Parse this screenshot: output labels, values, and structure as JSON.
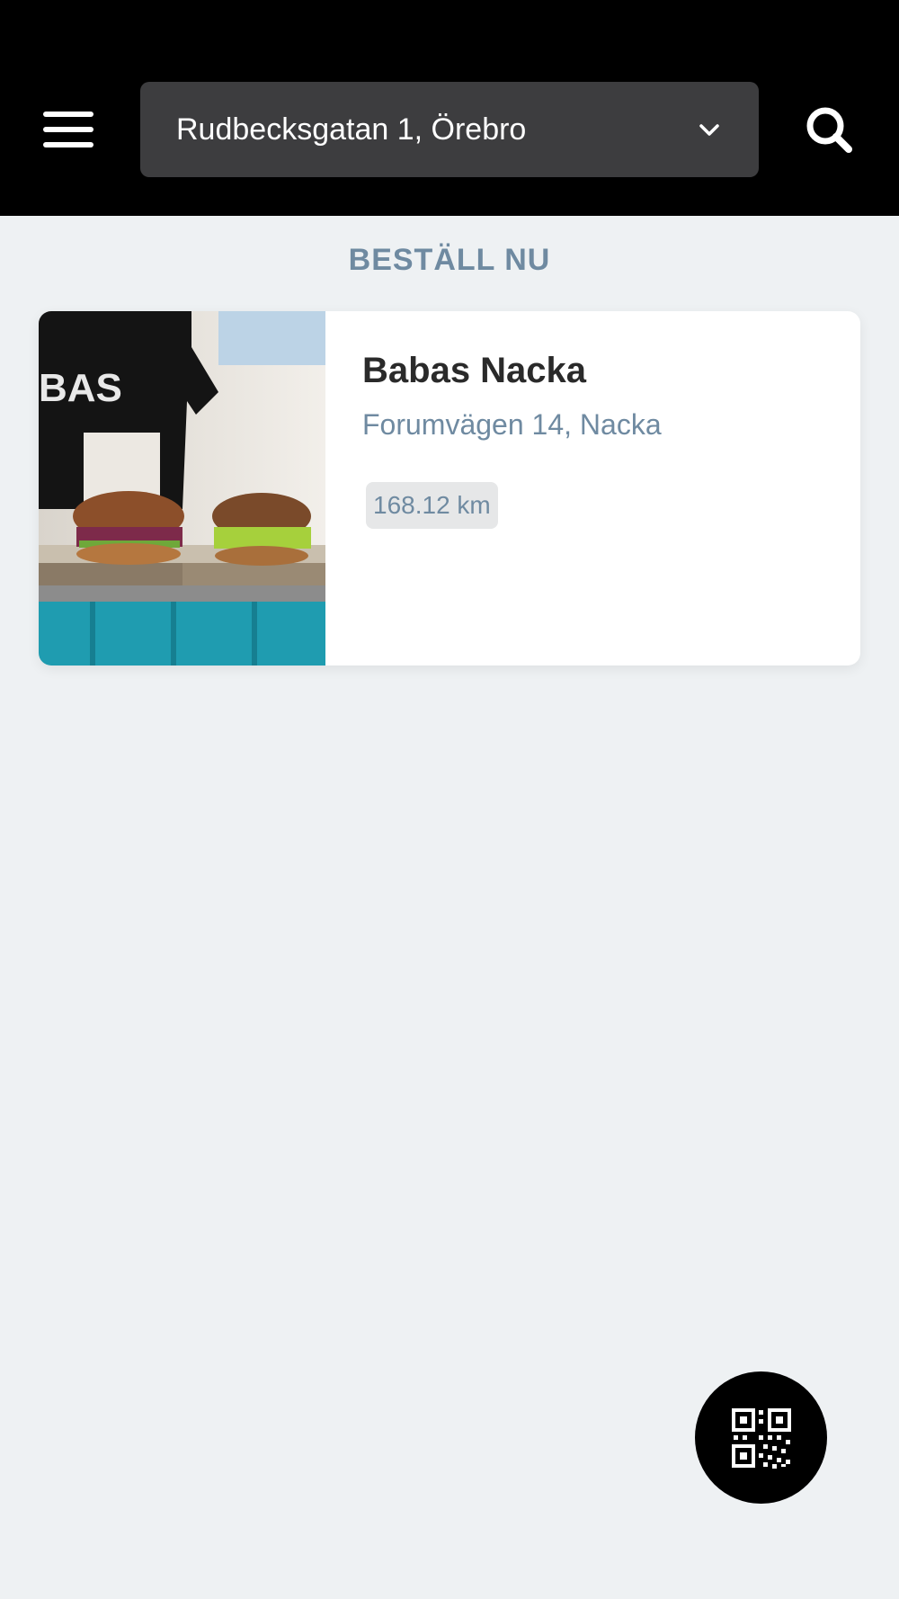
{
  "header": {
    "address": "Rudbecksgatan 1, Örebro",
    "menu_icon": "hamburger-menu-icon",
    "dropdown_icon": "chevron-down-icon",
    "search_icon": "search-icon"
  },
  "section": {
    "title": "BESTÄLL NU"
  },
  "restaurants": [
    {
      "name": "Babas Nacka",
      "address": "Forumvägen 14, Nacka",
      "distance": "168.12 km",
      "shirt_text": "BAS"
    }
  ],
  "fab": {
    "icon": "qr-code-icon"
  },
  "colors": {
    "header_bg": "#000000",
    "select_bg": "#3d3d3f",
    "page_bg": "#eef1f3",
    "accent_text": "#6f8aa1",
    "badge_bg": "#e6e7e8"
  }
}
